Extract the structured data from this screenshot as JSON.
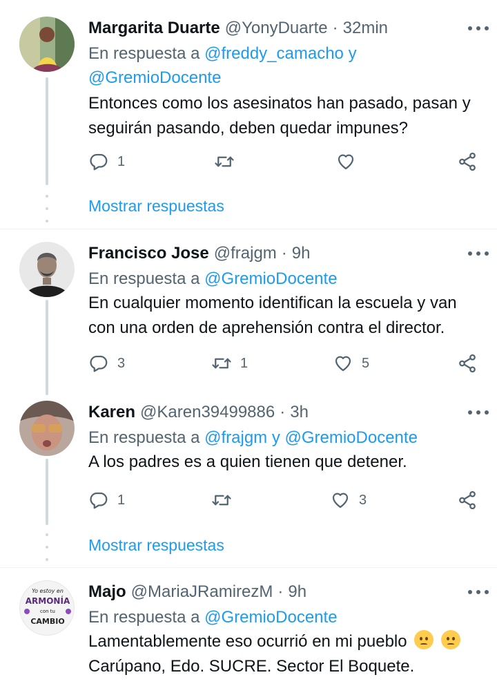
{
  "tweets": [
    {
      "name": "Margarita Duarte",
      "handle": "@YonyDuarte",
      "separator": "·",
      "time": "32min",
      "reply_prefix": "En respuesta a",
      "reply_mention_1": "@freddy_camacho y",
      "reply_mention_2": "@GremioDocente",
      "text": "Entonces como los asesinatos han pasado, pasan y seguirán pasando, deben quedar impunes?",
      "replies": "1",
      "retweets": "",
      "likes": "",
      "show_replies": "Mostrar respuestas"
    },
    {
      "name": "Francisco Jose",
      "handle": "@frajgm",
      "separator": "·",
      "time": "9h",
      "reply_prefix": "En respuesta a",
      "reply_mention_1": "@GremioDocente",
      "text": "En cualquier momento identifican la escuela y van con una orden de aprehensión contra el director.",
      "replies": "3",
      "retweets": "1",
      "likes": "5"
    },
    {
      "name": "Karen",
      "handle": "@Karen39499886",
      "separator": "·",
      "time": "3h",
      "reply_prefix": "En respuesta a",
      "reply_mention_1": "@frajgm y @GremioDocente",
      "text": "A los padres es a quien tienen que detener.",
      "replies": "1",
      "retweets": "",
      "likes": "3",
      "show_replies": "Mostrar respuestas"
    },
    {
      "name": "Majo",
      "handle": "@MariaJRamirezM",
      "separator": "·",
      "time": "9h",
      "reply_prefix": "En respuesta a",
      "reply_mention_1": "@GremioDocente",
      "text_line1": "Lamentablemente eso ocurrió en mi pueblo",
      "text_line2": "Carúpano,  Edo. SUCRE. Sector El Boquete.",
      "avatar_text": [
        "Yo estoy en",
        "ARMONÍA",
        "con tu",
        "CAMBIO"
      ]
    }
  ],
  "icons": {
    "reply": "reply-icon",
    "retweet": "retweet-icon",
    "like": "heart-icon",
    "share": "share-icon",
    "more": "more-icon"
  },
  "colors": {
    "link": "#1d9bf0",
    "secondary": "#536471",
    "primary_text": "#0f1419",
    "thread_line": "#cfd9de"
  }
}
